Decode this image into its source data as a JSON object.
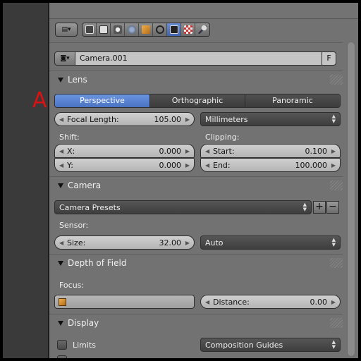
{
  "annotation": {
    "label": "A",
    "color": "#cc1111"
  },
  "object": {
    "name": "Camera.001",
    "fake_user_label": "F"
  },
  "sections": {
    "lens": {
      "title": "Lens",
      "type_options": [
        "Perspective",
        "Orthographic",
        "Panoramic"
      ],
      "active_type": "Perspective",
      "focal_length": {
        "label": "Focal Length:",
        "value": "105.00"
      },
      "focal_unit": "Millimeters",
      "shift": {
        "title": "Shift:",
        "x_label": "X:",
        "x_value": "0.000",
        "y_label": "Y:",
        "y_value": "0.000"
      },
      "clipping": {
        "title": "Clipping:",
        "start_label": "Start:",
        "start_value": "0.100",
        "end_label": "End:",
        "end_value": "100.000"
      }
    },
    "camera": {
      "title": "Camera",
      "presets_label": "Camera Presets",
      "sensor_title": "Sensor:",
      "size_label": "Size:",
      "size_value": "32.00",
      "fit_mode": "Auto"
    },
    "dof": {
      "title": "Depth of Field",
      "focus_title": "Focus:",
      "distance_label": "Distance:",
      "distance_value": "0.00"
    },
    "display": {
      "title": "Display",
      "limits_label": "Limits",
      "composition_label": "Composition Guides"
    }
  },
  "toolbar": {
    "tab_icons": [
      "render-icon",
      "render-layers-icon",
      "scene-icon",
      "world-icon",
      "object-icon",
      "constraints-icon",
      "camera-data-icon",
      "texture-icon",
      "physics-icon"
    ],
    "active_tab": "camera-data-icon"
  },
  "colors": {
    "active_blue": "#5a84d0",
    "panel_bg": "#727272"
  }
}
